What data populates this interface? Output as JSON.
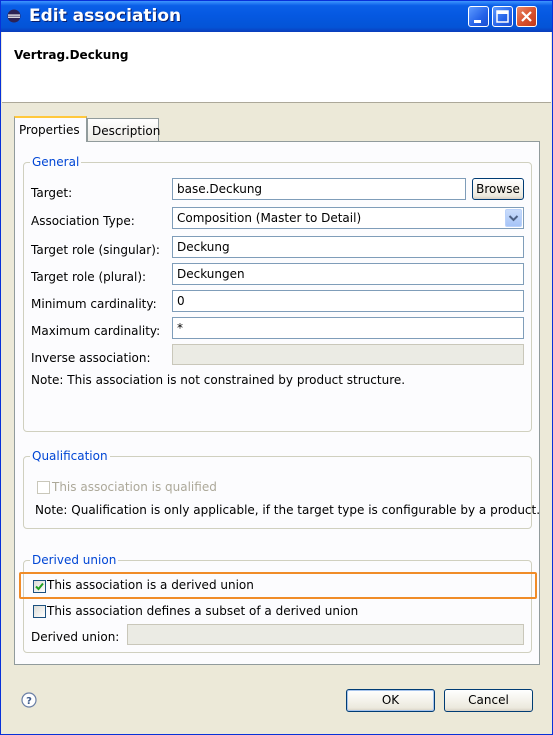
{
  "window": {
    "title": "Edit association"
  },
  "header": {
    "title": "Vertrag.Deckung"
  },
  "tabs": [
    {
      "label": "Properties"
    },
    {
      "label": "Description"
    }
  ],
  "general": {
    "legend": "General",
    "target": {
      "label": "Target:",
      "value": "base.Deckung",
      "browse_label": "Browse"
    },
    "association_type": {
      "label": "Association Type:",
      "value": "Composition (Master to Detail)"
    },
    "role_singular": {
      "label": "Target role (singular):",
      "value": "Deckung"
    },
    "role_plural": {
      "label": "Target role (plural):",
      "value": "Deckungen"
    },
    "min_card": {
      "label": "Minimum cardinality:",
      "value": "0"
    },
    "max_card": {
      "label": "Maximum cardinality:",
      "value": "*"
    },
    "inverse": {
      "label": "Inverse association:",
      "value": ""
    },
    "note": "Note: This association is not constrained by product structure."
  },
  "qualification": {
    "legend": "Qualification",
    "checkbox_label": "This association is qualified",
    "checked": false,
    "note": "Note: Qualification is only applicable, if the target type is configurable by a product."
  },
  "derived_union": {
    "legend": "Derived union",
    "is_derived_label": "This association is a derived union",
    "is_derived_checked": true,
    "subset_label": "This association defines a subset of a derived union",
    "subset_checked": false,
    "field_label": "Derived union:",
    "field_value": ""
  },
  "footer": {
    "ok_label": "OK",
    "cancel_label": "Cancel"
  },
  "colors": {
    "titlebar": "#0558e0",
    "group_label": "#0046d5",
    "highlight": "#f08c28"
  }
}
